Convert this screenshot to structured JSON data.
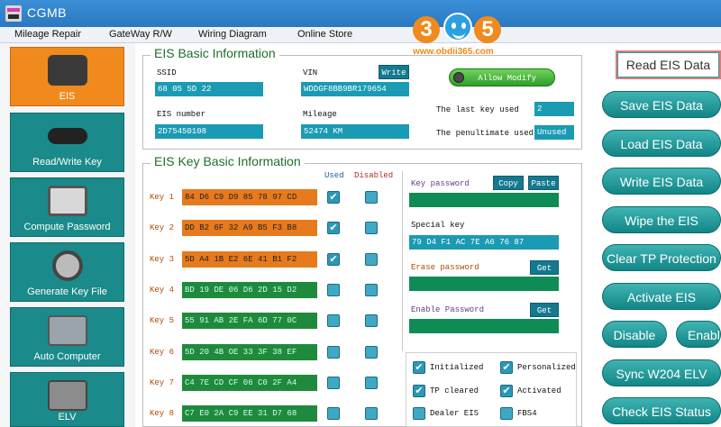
{
  "app": {
    "title": "CGMB"
  },
  "menu": [
    "Mileage Repair",
    "GateWay R/W",
    "Wiring Diagram",
    "Online Store"
  ],
  "logo": {
    "digit1": "3",
    "digit2": "5",
    "url": "www.obdii365.com"
  },
  "sidebar": [
    {
      "label": "EIS",
      "icon": "chip-icon",
      "active": true
    },
    {
      "label": "Read/Write Key",
      "icon": "car-key-icon",
      "active": false
    },
    {
      "label": "Compute Password",
      "icon": "keypad-icon",
      "active": false
    },
    {
      "label": "Generate Key File",
      "icon": "steering-lock-icon",
      "active": false
    },
    {
      "label": "Auto Computer",
      "icon": "ecu-icon",
      "active": false
    },
    {
      "label": "ELV",
      "icon": "elv-module-icon",
      "active": false
    }
  ],
  "basic": {
    "title": "EIS Basic Information",
    "ssid_label": "SSID",
    "ssid_value": "68 05 5D 22",
    "vin_label": "VIN",
    "vin_value": "WDDGF8BB9BR179654",
    "write_btn": "Write",
    "allow_btn": "Allow Modify",
    "eisnum_label": "EIS number",
    "eisnum_value": "2D75450108",
    "mileage_label": "Mileage",
    "mileage_value": "52474  KM",
    "lastkey_label": "The last key used",
    "lastkey_value": "2",
    "penult_label": "The penultimate used",
    "penult_value": "Unused"
  },
  "keyinfo": {
    "title": "EIS Key Basic Information",
    "used_head": "Used",
    "disabled_head": "Disabled",
    "keys": [
      {
        "label": "Key 1",
        "value": "84 D6 C9 D9 85 78 97 CD",
        "color": "orange",
        "used": true
      },
      {
        "label": "Key 2",
        "value": "DD B2 6F 32 A9 B5 F3 B8",
        "color": "orange",
        "used": true
      },
      {
        "label": "Key 3",
        "value": "5D A4 1B E2 6E 41 B1 F2",
        "color": "orange",
        "used": true
      },
      {
        "label": "Key 4",
        "value": "BD 19 DE 06 D6 2D 15 D2",
        "color": "green",
        "used": false
      },
      {
        "label": "Key 5",
        "value": "55 91 AB 2E FA 6D 77 0C",
        "color": "green",
        "used": false
      },
      {
        "label": "Key 6",
        "value": "5D 20 4B OE 33 3F 38 EF",
        "color": "green",
        "used": false
      },
      {
        "label": "Key 7",
        "value": "C4 7E CD CF 06 C0 2F A4",
        "color": "green",
        "used": false
      },
      {
        "label": "Key 8",
        "value": "C7 E0 2A C9 EE 31 D7 68",
        "color": "green",
        "used": false
      }
    ],
    "keypass_label": "Key password",
    "copy_btn": "Copy",
    "paste_btn": "Paste",
    "special_label": "Special key",
    "special_value": "79 D4 F1 AC 7E A6 76 87",
    "erase_label": "Erase password",
    "get_btn": "Get",
    "enable_label": "Enable Password",
    "get_btn2": "Get",
    "flags": [
      {
        "label": "Initialized",
        "checked": true
      },
      {
        "label": "Personalized",
        "checked": true
      },
      {
        "label": "TP cleared",
        "checked": true
      },
      {
        "label": "Activated",
        "checked": true
      },
      {
        "label": "Dealer EIS",
        "checked": false
      },
      {
        "label": "FBS4",
        "checked": false
      }
    ]
  },
  "actions": {
    "read": "Read  EIS Data",
    "save": "Save EIS Data",
    "load": "Load EIS Data",
    "write": "Write EIS Data",
    "wipe": "Wipe the EIS",
    "clear_tp": "Clear TP Protection",
    "activate": "Activate EIS",
    "disable": "Disable",
    "enable": "Enable",
    "sync": "Sync W204 ELV",
    "check": "Check EIS Status"
  }
}
